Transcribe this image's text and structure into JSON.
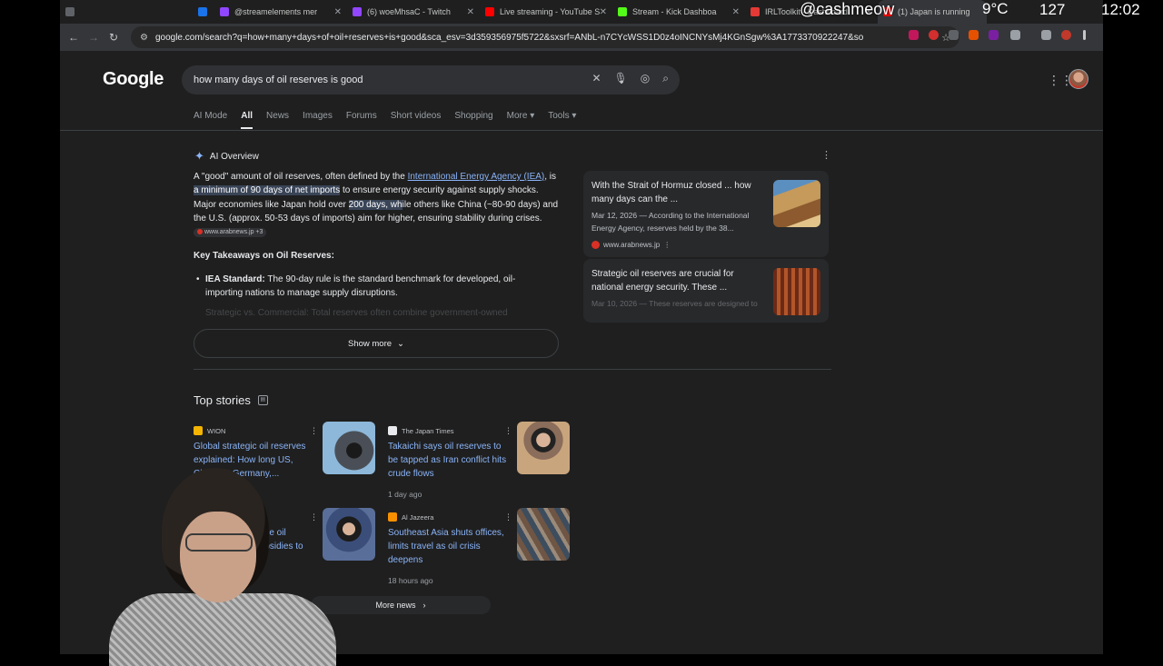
{
  "tabs": [
    {
      "title": "",
      "color": "#5f6368"
    },
    {
      "title": "",
      "color": "#1a73e8"
    },
    {
      "title": "@streamelements mer",
      "color": "#9146ff"
    },
    {
      "title": "(6) woeMhsaC - Twitch",
      "color": "#9146ff"
    },
    {
      "title": "Live streaming - YouTube S",
      "color": "#ff0000"
    },
    {
      "title": "Stream - Kick Dashboa",
      "color": "#53fc18"
    },
    {
      "title": "IRLToolkit - Dashboard",
      "color": "#e53935"
    },
    {
      "title": "(1) Japan is running",
      "color": "#ff0000"
    }
  ],
  "overlay": {
    "handle": "@cashmeow",
    "temp": "9°C",
    "count": "127",
    "clock": "12:02"
  },
  "address_bar": {
    "url": "google.com/search?q=how+many+days+of+oil+reserves+is+good&sca_esv=3d359356975f5722&sxsrf=ANbL-n7CYcWSS1D0z4oINCNYsMj4KGnSgw%3A1773370922247&source=hp&ei..."
  },
  "google": {
    "logo": "Google",
    "query": "how many days of oil reserves is good",
    "search_tabs": [
      "AI Mode",
      "All",
      "News",
      "Images",
      "Forums",
      "Short videos",
      "Shopping",
      "More",
      "Tools"
    ]
  },
  "ai_overview": {
    "label": "AI Overview",
    "p1_a": "A \"good\" amount of oil reserves, often defined by the ",
    "p1_link": "International Energy Agency (IEA)",
    "p1_b": ", is ",
    "p1_hl1": "a minimum of 90 days of net imports",
    "p1_c": " to ensure energy security against supply shocks. Major economies like Japan hold over ",
    "p1_hl2": "200 days, wh",
    "p1_d": "ile others like China (~80-90 days) and the U.S. (approx. 50-53 days of imports) aim for higher, ensuring stability during crises. ",
    "source_chip": "www.arabnews.jp +3",
    "key_takeaways": "Key Takeaways on Oil Reserves:",
    "bullet1_bold": "IEA Standard:",
    "bullet1_text": " The 90-day rule is the standard benchmark for developed, oil-importing nations to manage supply disruptions.",
    "faded_line": "Strategic vs. Commercial: Total reserves often combine government-owned",
    "show_more": "Show more"
  },
  "right_cards": [
    {
      "title": "With the Strait of Hormuz closed ... how many days can the ...",
      "snippet": "Mar 12, 2026 — According to the International Energy Agency, reserves held by the 38...",
      "source": "www.arabnews.jp"
    },
    {
      "title": "Strategic oil reserves are crucial for national energy security. These ...",
      "snippet": "Mar 10, 2026 — These reserves are designed to",
      "source": ""
    }
  ],
  "top_stories": {
    "title": "Top stories",
    "items": [
      {
        "publisher": "WION",
        "logo_color": "#f4b400",
        "headline": "Global strategic oil reserves explained: How long US, China, ... Germany,...",
        "age": ""
      },
      {
        "publisher": "The Japan Times",
        "logo_color": "#e8eaed",
        "headline": "Takaichi says oil reserves to be tapped as Iran conflict hits crude flows",
        "age": "1 day ago"
      },
      {
        "publisher": "",
        "logo_color": "#5f6368",
        "headline": "...se oil ...bsidies to",
        "age": ""
      },
      {
        "publisher": "Al Jazeera",
        "logo_color": "#fa9000",
        "headline": "Southeast Asia shuts offices, limits travel as oil crisis deepens",
        "age": "18 hours ago"
      }
    ],
    "more_news": "More news"
  }
}
